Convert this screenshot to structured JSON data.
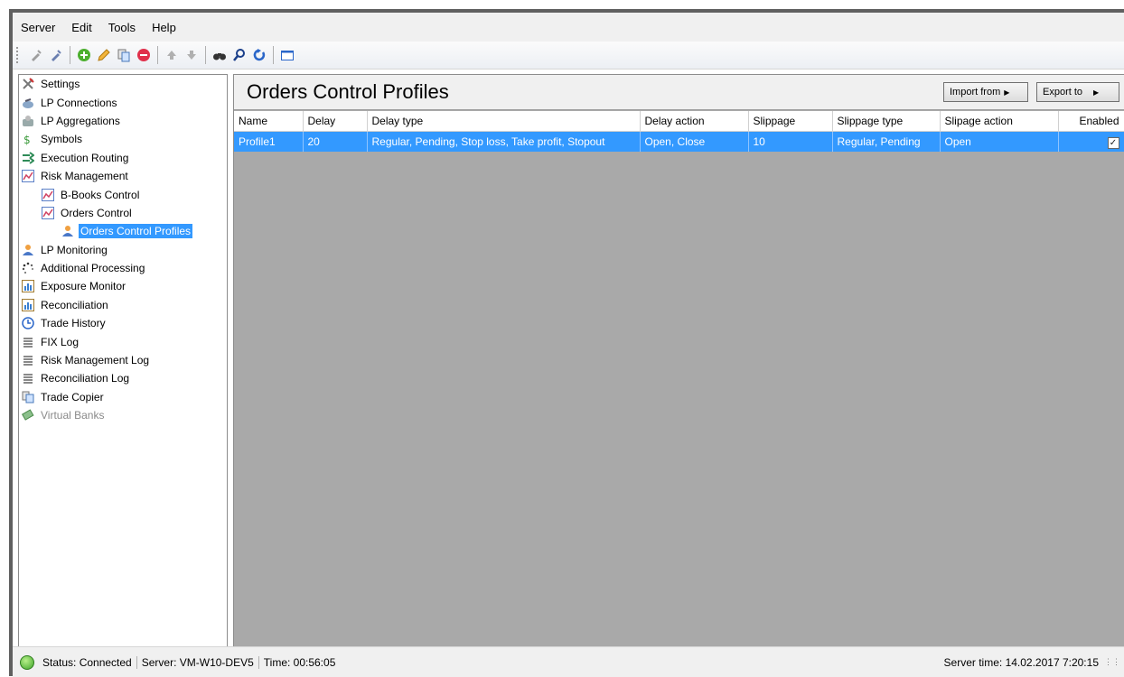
{
  "menu": [
    "Server",
    "Edit",
    "Tools",
    "Help"
  ],
  "toolbar_icons": [
    "connect-icon",
    "disconnect-icon",
    "add-icon",
    "edit-icon",
    "copy-icon",
    "remove-icon",
    "move-up-icon",
    "move-down-icon",
    "find-icon",
    "search-icon",
    "refresh-icon",
    "window-icon"
  ],
  "tree": [
    {
      "label": "Settings",
      "icon": "settings-icon",
      "level": 0
    },
    {
      "label": "LP Connections",
      "icon": "lp-connections-icon",
      "level": 0
    },
    {
      "label": "LP Aggregations",
      "icon": "lp-aggregations-icon",
      "level": 0
    },
    {
      "label": "Symbols",
      "icon": "symbols-icon",
      "level": 0
    },
    {
      "label": "Execution Routing",
      "icon": "execution-routing-icon",
      "level": 0
    },
    {
      "label": "Risk Management",
      "icon": "risk-management-icon",
      "level": 0
    },
    {
      "label": "B-Books Control",
      "icon": "chart-icon",
      "level": 1
    },
    {
      "label": "Orders Control",
      "icon": "chart-icon",
      "level": 1
    },
    {
      "label": "Orders Control Profiles",
      "icon": "user-icon",
      "level": 2,
      "selected": true
    },
    {
      "label": "LP Monitoring",
      "icon": "user-icon",
      "level": 0
    },
    {
      "label": "Additional Processing",
      "icon": "processing-icon",
      "level": 0
    },
    {
      "label": "Exposure Monitor",
      "icon": "bar-chart-icon",
      "level": 0
    },
    {
      "label": "Reconciliation",
      "icon": "bar-chart-icon",
      "level": 0
    },
    {
      "label": "Trade History",
      "icon": "history-icon",
      "level": 0
    },
    {
      "label": "FIX Log",
      "icon": "log-icon",
      "level": 0
    },
    {
      "label": "Risk Management Log",
      "icon": "log-icon",
      "level": 0
    },
    {
      "label": "Reconciliation Log",
      "icon": "log-icon",
      "level": 0
    },
    {
      "label": "Trade Copier",
      "icon": "copier-icon",
      "level": 0
    },
    {
      "label": "Virtual Banks",
      "icon": "bank-icon",
      "level": 0,
      "disabled": true
    }
  ],
  "content": {
    "title": "Orders Control Profiles",
    "import_label": "Import from",
    "export_label": "Export to"
  },
  "grid": {
    "columns": [
      "Name",
      "Delay",
      "Delay type",
      "Delay action",
      "Slippage",
      "Slippage type",
      "Slipage action",
      "Enabled"
    ],
    "rows": [
      [
        "Profile1",
        "20",
        "Regular, Pending, Stop loss, Take profit, Stopout",
        "Open, Close",
        "10",
        "Regular, Pending",
        "Open",
        ""
      ]
    ],
    "enabled": [
      true
    ]
  },
  "status": {
    "status": "Status: Connected",
    "server": "Server: VM-W10-DEV5",
    "time": "Time: 00:56:05",
    "server_time": "Server time: 14.02.2017 7:20:15"
  }
}
